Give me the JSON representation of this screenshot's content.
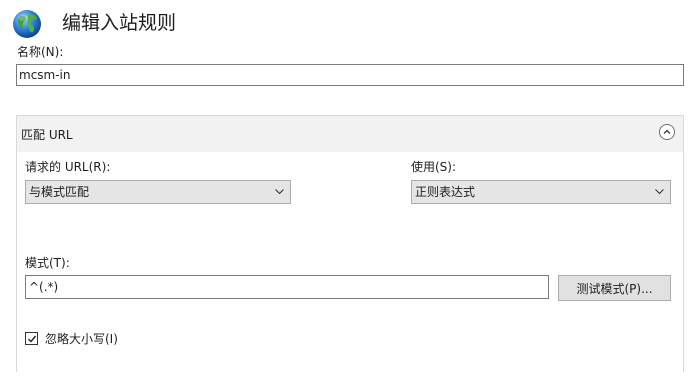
{
  "header": {
    "title": "编辑入站规则",
    "icon": "globe-icon"
  },
  "name_field": {
    "label": "名称(N):",
    "value": "mcsm-in"
  },
  "match_url": {
    "title": "匹配 URL",
    "requested_url": {
      "label": "请求的 URL(R):",
      "value": "与模式匹配"
    },
    "using": {
      "label": "使用(S):",
      "value": "正则表达式"
    },
    "pattern": {
      "label": "模式(T):",
      "value": "^(.*)"
    },
    "test_button": "测试模式(P)...",
    "ignore_case": {
      "label": "忽略大小写(I)",
      "checked": true
    }
  },
  "colors": {
    "panel_header": "#f2f2f2",
    "select_bg": "#e5e5e5",
    "button_bg": "#e1e1e1"
  }
}
